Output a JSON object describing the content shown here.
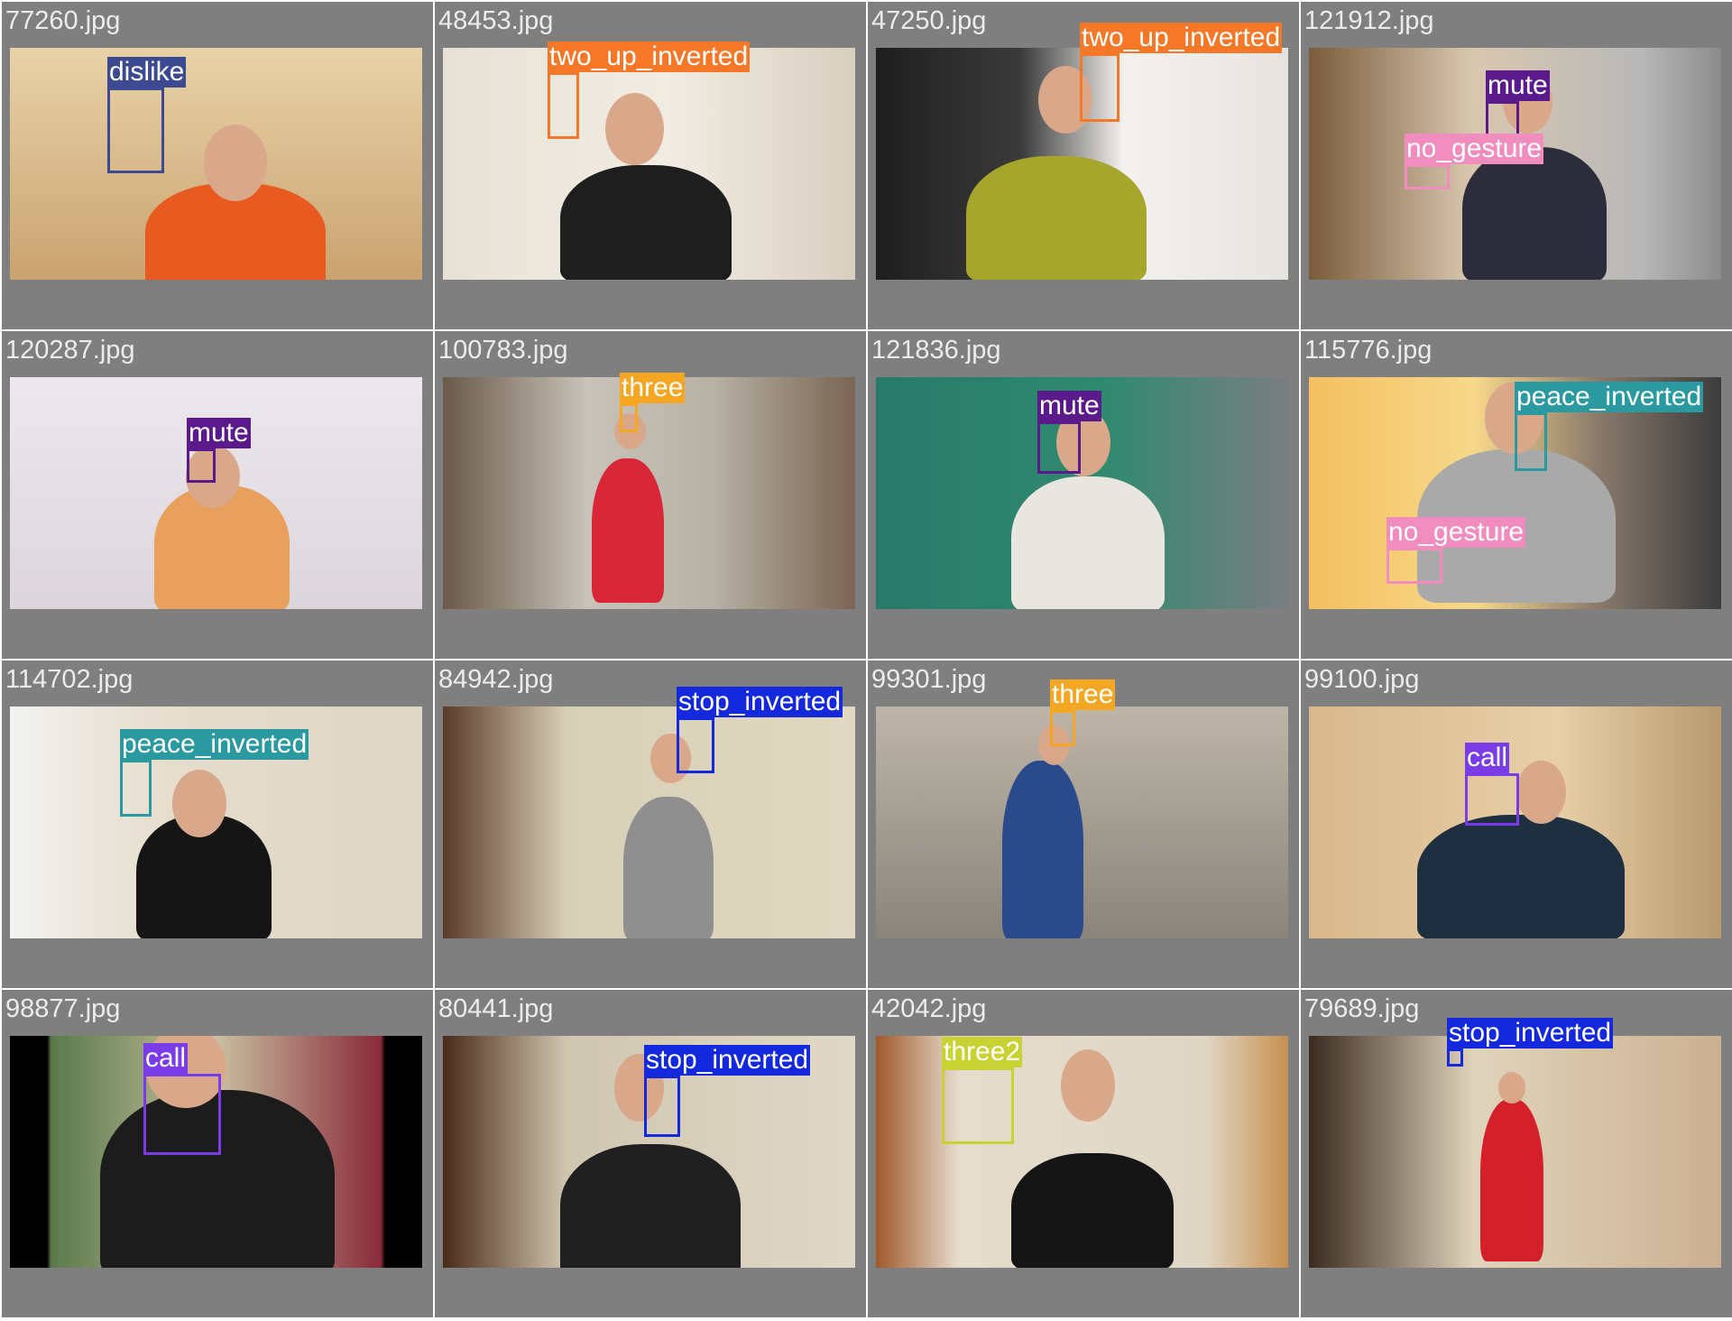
{
  "colors": {
    "dislike": "#3c4a91",
    "two_up_inverted": "#f57828",
    "mute": "#5a1a8c",
    "no_gesture": "#f08cbe",
    "three": "#f5a623",
    "peace_inverted": "#2a9aa0",
    "stop_inverted": "#1428dc",
    "call": "#7a3ce6",
    "three2": "#c8d232"
  },
  "tiles": [
    {
      "file": "77260.jpg",
      "labels": [
        "dislike"
      ]
    },
    {
      "file": "48453.jpg",
      "labels": [
        "two_up_inverted"
      ]
    },
    {
      "file": "47250.jpg",
      "labels": [
        "two_up_inverted"
      ]
    },
    {
      "file": "121912.jpg",
      "labels": [
        "mute",
        "no_gesture"
      ]
    },
    {
      "file": "120287.jpg",
      "labels": [
        "mute"
      ]
    },
    {
      "file": "100783.jpg",
      "labels": [
        "three"
      ]
    },
    {
      "file": "121836.jpg",
      "labels": [
        "mute"
      ]
    },
    {
      "file": "115776.jpg",
      "labels": [
        "peace_inverted",
        "no_gesture"
      ]
    },
    {
      "file": "114702.jpg",
      "labels": [
        "peace_inverted"
      ]
    },
    {
      "file": "84942.jpg",
      "labels": [
        "stop_inverted"
      ]
    },
    {
      "file": "99301.jpg",
      "labels": [
        "three"
      ]
    },
    {
      "file": "99100.jpg",
      "labels": [
        "call"
      ]
    },
    {
      "file": "98877.jpg",
      "labels": [
        "call"
      ]
    },
    {
      "file": "80441.jpg",
      "labels": [
        "stop_inverted"
      ]
    },
    {
      "file": "42042.jpg",
      "labels": [
        "three2"
      ]
    },
    {
      "file": "79689.jpg",
      "labels": [
        "stop_inverted"
      ]
    }
  ]
}
